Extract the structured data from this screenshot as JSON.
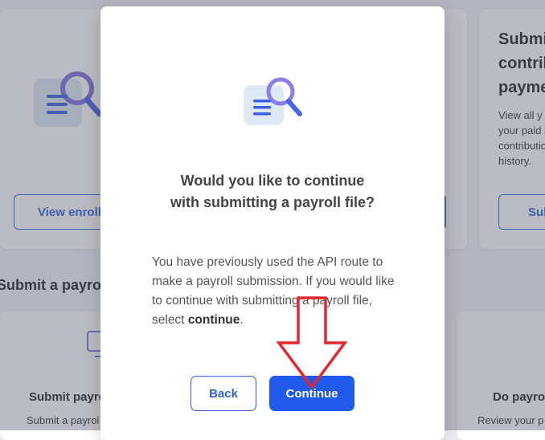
{
  "background": {
    "card_left_button": "View enrolle",
    "card_right_title_lines": [
      "Submi",
      "contrib",
      "payme"
    ],
    "card_right_text_lines": [
      "View all y",
      "your paid a",
      "contributio",
      "history."
    ],
    "card_right_button": "Sub",
    "section_heading": "Submit a payrol",
    "card_bottom_left_title": "Submit payro",
    "card_bottom_left_text": "Submit a payrol",
    "card_bottom_right_title": "Do payro",
    "card_bottom_right_text": "Review your p"
  },
  "modal": {
    "icon": "document-search-icon",
    "title": "Would you like to continue with submitting a payroll file?",
    "body_pre": "You have previously used the API route to make a payroll submission. If you would like to continue with submitting a payroll file, select ",
    "body_bold": "continue",
    "body_post": ".",
    "back_label": "Back",
    "continue_label": "Continue"
  },
  "annotation": {
    "icon": "red-arrow-down-icon",
    "color": "#e3262b"
  },
  "colors": {
    "accent": "#1f5bea",
    "outline": "#2f5fd8"
  }
}
